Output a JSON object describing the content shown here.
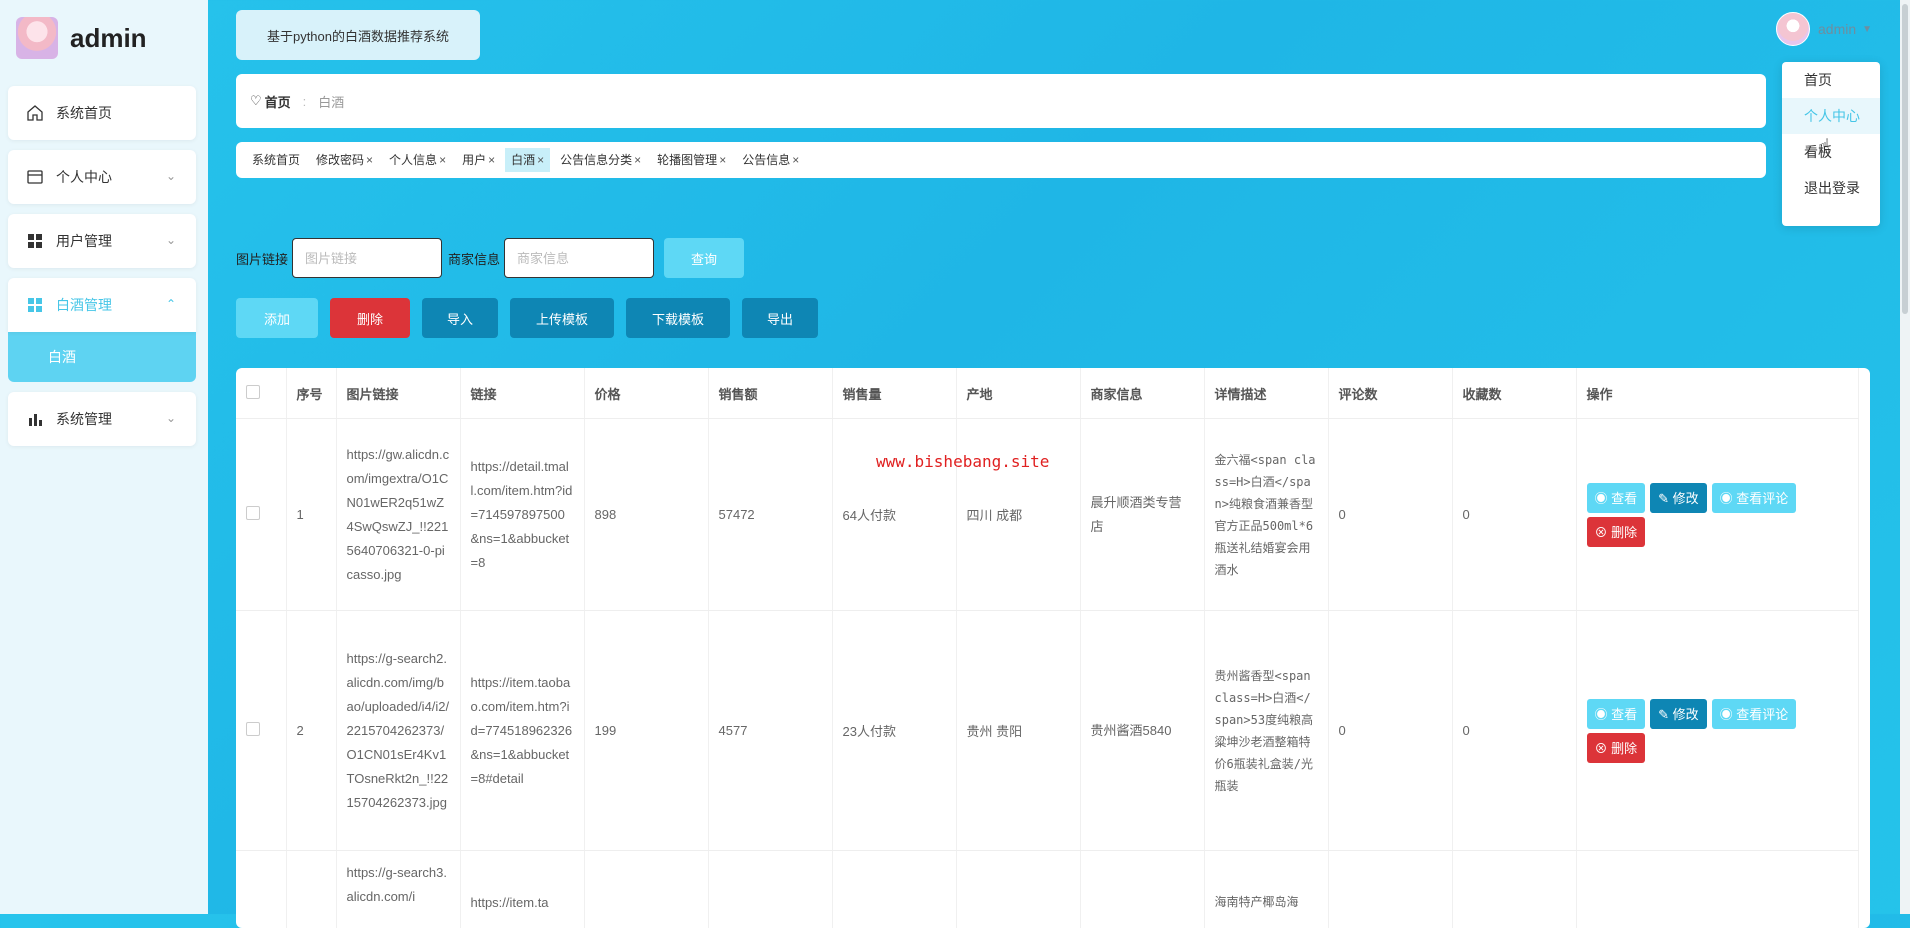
{
  "brand": {
    "title": "admin"
  },
  "sidebar": {
    "items": [
      {
        "label": "系统首页",
        "icon": "home-icon"
      },
      {
        "label": "个人中心",
        "icon": "card-icon"
      },
      {
        "label": "用户管理",
        "icon": "grid-icon"
      },
      {
        "label": "白酒管理",
        "icon": "grid-icon",
        "sub": "白酒"
      },
      {
        "label": "系统管理",
        "icon": "bar-chart-icon"
      }
    ]
  },
  "header": {
    "system_title": "基于python的白酒数据推荐系统",
    "user_name": "admin",
    "dropdown": [
      "首页",
      "个人中心",
      "看板",
      "退出登录"
    ]
  },
  "breadcrumb": {
    "home": "首页",
    "current": "白酒"
  },
  "tabs": [
    "系统首页",
    "修改密码",
    "个人信息",
    "用户",
    "白酒",
    "公告信息分类",
    "轮播图管理",
    "公告信息"
  ],
  "search": {
    "field1_label": "图片链接",
    "field1_placeholder": "图片链接",
    "field2_label": "商家信息",
    "field2_placeholder": "商家信息",
    "query_label": "查询"
  },
  "actions": {
    "add": "添加",
    "delete": "删除",
    "import": "导入",
    "upload_template": "上传模板",
    "download_template": "下载模板",
    "export": "导出"
  },
  "table": {
    "columns": [
      "序号",
      "图片链接",
      "链接",
      "价格",
      "销售额",
      "销售量",
      "产地",
      "商家信息",
      "详情描述",
      "评论数",
      "收藏数",
      "操作"
    ],
    "rows": [
      {
        "index": "1",
        "image_link": "https://gw.alicdn.com/imgextra/O1CN01wER2q51wZ4SwQswZJ_!!2215640706321-0-picasso.jpg",
        "link": "https://detail.tmall.com/item.htm?id=714597897500&ns=1&abbucket=8",
        "price": "898",
        "sales_amount": "57472",
        "sales_volume": "64人付款",
        "origin": "四川 成都",
        "merchant": "晨升顺酒类专营店",
        "description": "金六福<span class=H>白酒</span>纯粮食酒兼香型官方正品500ml*6瓶送礼结婚宴会用酒水",
        "comments": "0",
        "favorites": "0"
      },
      {
        "index": "2",
        "image_link": "https://g-search2.alicdn.com/img/bao/uploaded/i4/i2/2215704262373/O1CN01sEr4Kv1TOsneRkt2n_!!2215704262373.jpg",
        "link": "https://item.taobao.com/item.htm?id=774518962326&ns=1&abbucket=8#detail",
        "price": "199",
        "sales_amount": "4577",
        "sales_volume": "23人付款",
        "origin": "贵州 贵阳",
        "merchant": "贵州酱酒5840",
        "description": "贵州酱香型<span class=H>白酒</span>53度纯粮高粱坤沙老酒整箱特价6瓶装礼盒装/光瓶装",
        "comments": "0",
        "favorites": "0"
      },
      {
        "index": "",
        "image_link": "https://g-search3.alicdn.com/i",
        "link": "https://item.ta",
        "price": "",
        "sales_amount": "",
        "sales_volume": "",
        "origin": "",
        "merchant": "",
        "description": "海南特产椰岛海",
        "comments": "",
        "favorites": ""
      }
    ],
    "op_buttons": {
      "view": "查看",
      "edit": "修改",
      "view_comments": "查看评论",
      "delete": "删除"
    }
  },
  "watermark": "www.bishebang.site"
}
